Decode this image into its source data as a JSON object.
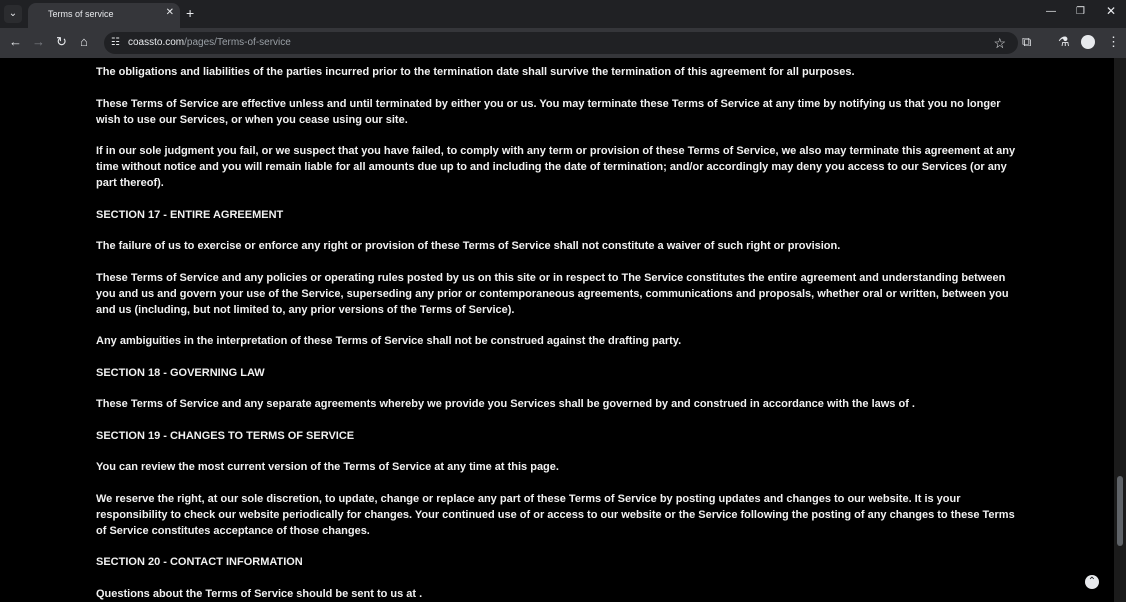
{
  "browser": {
    "tab_title": "Terms of service",
    "url_domain": "coassto.com",
    "url_path": "/pages/Terms-of-service",
    "icons": [
      "tab-menu-icon",
      "close-icon",
      "plus-icon",
      "minimize-icon",
      "restore-icon",
      "window-close-icon",
      "back-icon",
      "forward-icon",
      "reload-icon",
      "home-icon",
      "site-info-icon",
      "star-icon",
      "extensions-icon",
      "labs-icon",
      "profile-icon",
      "more-icon",
      "scroll-to-top-icon"
    ]
  },
  "document": {
    "paragraphs": [
      "The obligations and liabilities of the parties incurred prior to the termination date shall survive the termination of this agreement for all purposes.",
      "These Terms of Service are effective unless and until terminated by either you or us. You may terminate these Terms of Service at any time by notifying us that you no longer wish to use our Services, or when you cease using our site.",
      "If in our sole judgment you fail, or we suspect that you have failed, to comply with any term or provision of these Terms of Service, we also may terminate this agreement at any time without notice and you will remain liable for all amounts due up to and including the date of termination; and/or accordingly may deny you access to our Services (or any part thereof).",
      "SECTION 17 - ENTIRE AGREEMENT",
      "The failure of us to exercise or enforce any right or provision of these Terms of Service shall not constitute a waiver of such right or provision.",
      "These Terms of Service and any policies or operating rules posted by us on this site or in respect to The Service constitutes the entire agreement and understanding between you and us and govern your use of the Service, superseding any prior or contemporaneous agreements, communications and proposals, whether oral or written, between you and us (including, but not limited to, any prior versions of the Terms of Service).",
      "Any ambiguities in the interpretation of these Terms of Service shall not be construed against the drafting party.",
      "SECTION 18 - GOVERNING LAW",
      "These Terms of Service and any separate agreements whereby we provide you Services shall be governed by and construed in accordance with the laws of .",
      "SECTION 19 - CHANGES TO TERMS OF SERVICE",
      "You can review the most current version of the Terms of Service at any time at this page.",
      "We reserve the right, at our sole discretion, to update, change or replace any part of these Terms of Service by posting updates and changes to our website. It is your responsibility to check our website periodically for changes. Your continued use of or access to our website or the Service following the posting of any changes to these Terms of Service constitutes acceptance of those changes.",
      "SECTION 20 - CONTACT INFORMATION",
      "Questions about the Terms of Service should be sent to us at ."
    ]
  }
}
